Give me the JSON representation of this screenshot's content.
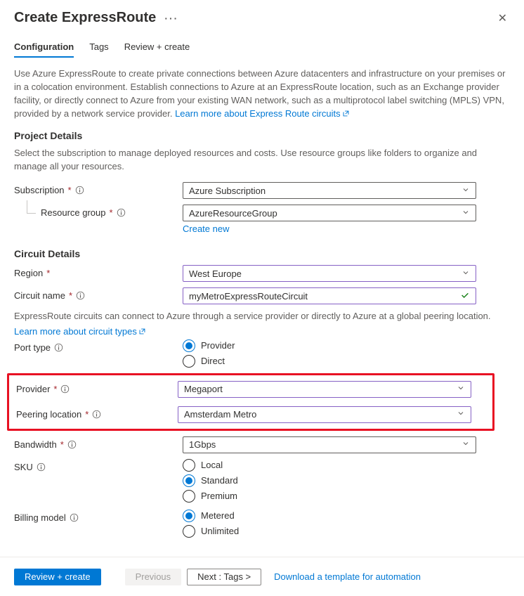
{
  "header": {
    "title": "Create ExpressRoute",
    "ellipsis": "···"
  },
  "tabs": {
    "config": "Configuration",
    "tags": "Tags",
    "review": "Review + create"
  },
  "intro": {
    "text": "Use Azure ExpressRoute to create private connections between Azure datacenters and infrastructure on your premises or in a colocation environment. Establish connections to Azure at an ExpressRoute location, such as an Exchange provider facility, or directly connect to Azure from your existing WAN network, such as a multiprotocol label switching (MPLS) VPN, provided by a network service provider. ",
    "link": "Learn more about Express Route circuits"
  },
  "project": {
    "heading": "Project Details",
    "sub": "Select the subscription to manage deployed resources and costs. Use resource groups like folders to organize and manage all your resources.",
    "subscription_label": "Subscription",
    "subscription_value": "Azure Subscription",
    "rg_label": "Resource group",
    "rg_value": "AzureResourceGroup",
    "create_new": "Create new"
  },
  "circuit": {
    "heading": "Circuit Details",
    "region_label": "Region",
    "region_value": "West Europe",
    "name_label": "Circuit name",
    "name_value": "myMetroExpressRouteCircuit",
    "note": "ExpressRoute circuits can connect to Azure through a service provider or directly to Azure at a global peering location.",
    "note_link": "Learn more about circuit types",
    "port_type_label": "Port type",
    "port_provider": "Provider",
    "port_direct": "Direct",
    "provider_label": "Provider",
    "provider_value": "Megaport",
    "peering_label": "Peering location",
    "peering_value": "Amsterdam Metro",
    "bandwidth_label": "Bandwidth",
    "bandwidth_value": "1Gbps",
    "sku_label": "SKU",
    "sku_local": "Local",
    "sku_standard": "Standard",
    "sku_premium": "Premium",
    "billing_label": "Billing model",
    "billing_metered": "Metered",
    "billing_unlimited": "Unlimited"
  },
  "footer": {
    "review": "Review + create",
    "previous": "Previous",
    "next": "Next : Tags >",
    "download": "Download a template for automation"
  }
}
